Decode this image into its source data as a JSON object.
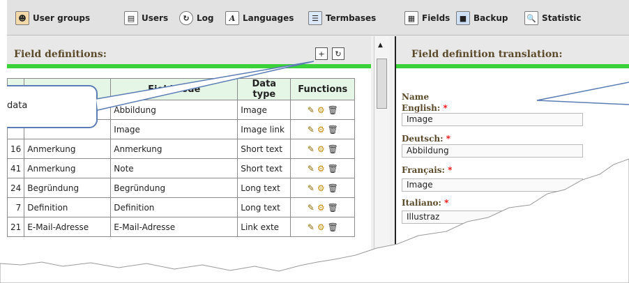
{
  "toolbar": {
    "items": [
      {
        "label": "User groups",
        "icon": "user-groups-icon"
      },
      {
        "label": "Users",
        "icon": "users-icon"
      },
      {
        "label": "Log",
        "icon": "log-icon"
      },
      {
        "label": "Languages",
        "icon": "languages-icon"
      },
      {
        "label": "Termbases",
        "icon": "termbases-icon"
      },
      {
        "label": "Fields",
        "icon": "fields-icon"
      },
      {
        "label": "Backup",
        "icon": "backup-icon"
      },
      {
        "label": "Statistic",
        "icon": "statistic-icon"
      }
    ]
  },
  "left_panel": {
    "title": "Field definitions:",
    "table": {
      "headers": [
        "",
        "",
        "Field code",
        "Data type",
        "Functions"
      ],
      "rows": [
        {
          "id": "",
          "name": "",
          "code": "Abbildung",
          "type": "Image"
        },
        {
          "id": "",
          "name": "",
          "code": "Image",
          "type": "Image link"
        },
        {
          "id": "16",
          "name": "Anmerkung",
          "code": "Anmerkung",
          "type": "Short text"
        },
        {
          "id": "41",
          "name": "Anmerkung",
          "code": "Note",
          "type": "Short text"
        },
        {
          "id": "24",
          "name": "Begründung",
          "code": "Begründung",
          "type": "Long text"
        },
        {
          "id": "7",
          "name": "Definition",
          "code": "Definition",
          "type": "Long text"
        },
        {
          "id": "21",
          "name": "E-Mail-Adresse",
          "code": "E-Mail-Adresse",
          "type": "Link exte"
        }
      ]
    }
  },
  "right_panel": {
    "title": "Field definition translation:",
    "name_label": "Name",
    "fields": [
      {
        "label": "English:",
        "value": "Image"
      },
      {
        "label": "Deutsch:",
        "value": "Abbildung"
      },
      {
        "label": "Français:",
        "value": "Image"
      },
      {
        "label": "Italiano:",
        "value": "Illustraz"
      }
    ],
    "required_mark": "*"
  },
  "callout": {
    "text": "data"
  },
  "colors": {
    "accent_green": "#39d239",
    "callout_border": "#5b7db5",
    "header_text": "#5b4a2a",
    "required": "#e00000"
  }
}
